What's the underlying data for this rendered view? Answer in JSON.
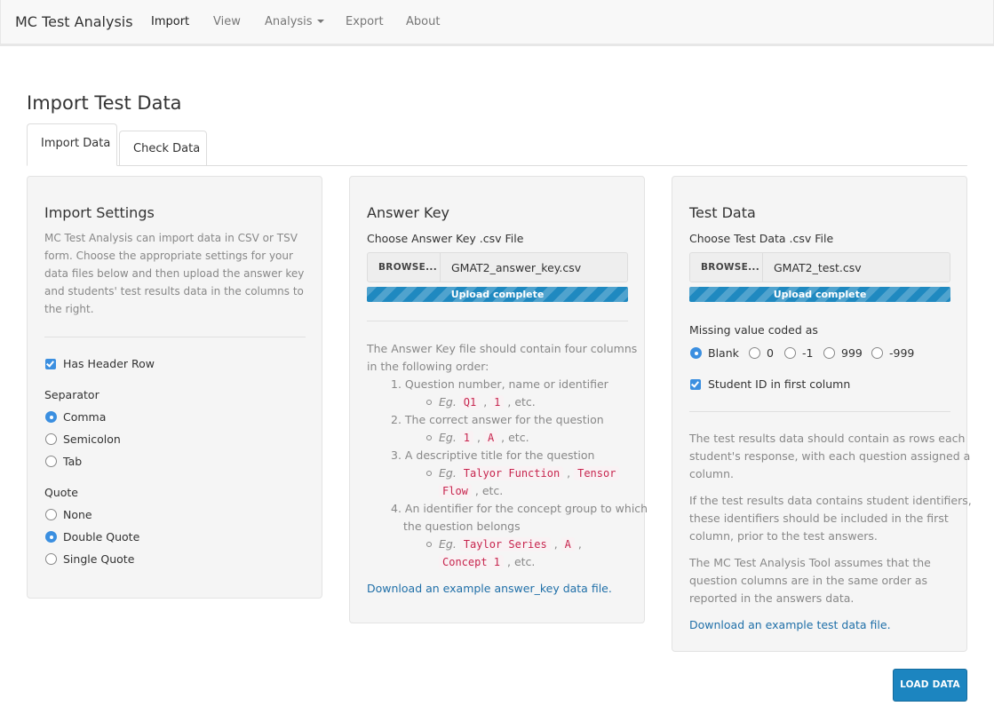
{
  "nav": {
    "brand": "MC Test Analysis",
    "items": [
      "Import",
      "View",
      "Analysis",
      "Export",
      "About"
    ]
  },
  "page": {
    "title": "Import Test Data",
    "tabs": [
      "Import Data",
      "Check Data"
    ]
  },
  "settings": {
    "title": "Import Settings",
    "desc": "MC Test Analysis can import data in CSV or TSV form. Choose the appropriate settings for your data files below and then upload the answer key and students' test results data in the columns to the right.",
    "has_header": "Has Header Row",
    "separator_label": "Separator",
    "separators": [
      "Comma",
      "Semicolon",
      "Tab"
    ],
    "quote_label": "Quote",
    "quotes": [
      "None",
      "Double Quote",
      "Single Quote"
    ]
  },
  "answer_key": {
    "title": "Answer Key",
    "choose_label": "Choose Answer Key .csv File",
    "browse": "BROWSE...",
    "filename": "GMAT2_answer_key.csv",
    "progress_text": "Upload complete",
    "intro1": "The Answer Key file should contain four columns",
    "intro2": "in the following order:",
    "items": [
      "1. Question number, name or identifier",
      "2. The correct answer for the question",
      "3. A descriptive title for the question",
      "4. An identifier for the concept group to which",
      "the question belongs"
    ],
    "eg": "Eg.",
    "etc": ", etc.",
    "codes": {
      "q1": "Q1",
      "one": "1",
      "a": "A",
      "talyor": "Talyor Function",
      "tensor": "Tensor",
      "flow": "Flow",
      "taylor_series": "Taylor Series",
      "concept1": "Concept 1"
    },
    "download": "Download an example answer_key data file."
  },
  "test_data": {
    "title": "Test Data",
    "choose_label": "Choose Test Data .csv File",
    "browse": "BROWSE...",
    "filename": "GMAT2_test.csv",
    "progress_text": "Upload complete",
    "missing_label": "Missing value coded as",
    "missing_options": [
      "Blank",
      "0",
      "-1",
      "999",
      "-999"
    ],
    "student_id": "Student ID in first column",
    "para1": [
      "The test results data should contain as rows each",
      "student's response, with each question assigned a",
      "column."
    ],
    "para2": [
      "If the test results data contains student identifiers,",
      "these identifiers should be included in the first",
      "column, prior to the test answers."
    ],
    "para3": [
      "The MC Test Analysis Tool assumes that the",
      "question columns are in the same order as",
      "reported in the answers data."
    ],
    "download": "Download an example test data file."
  },
  "load_button": "LOAD DATA",
  "colors": {
    "accent": "#1c85c0",
    "link": "#1f6fa8",
    "code": "#c7254e"
  }
}
